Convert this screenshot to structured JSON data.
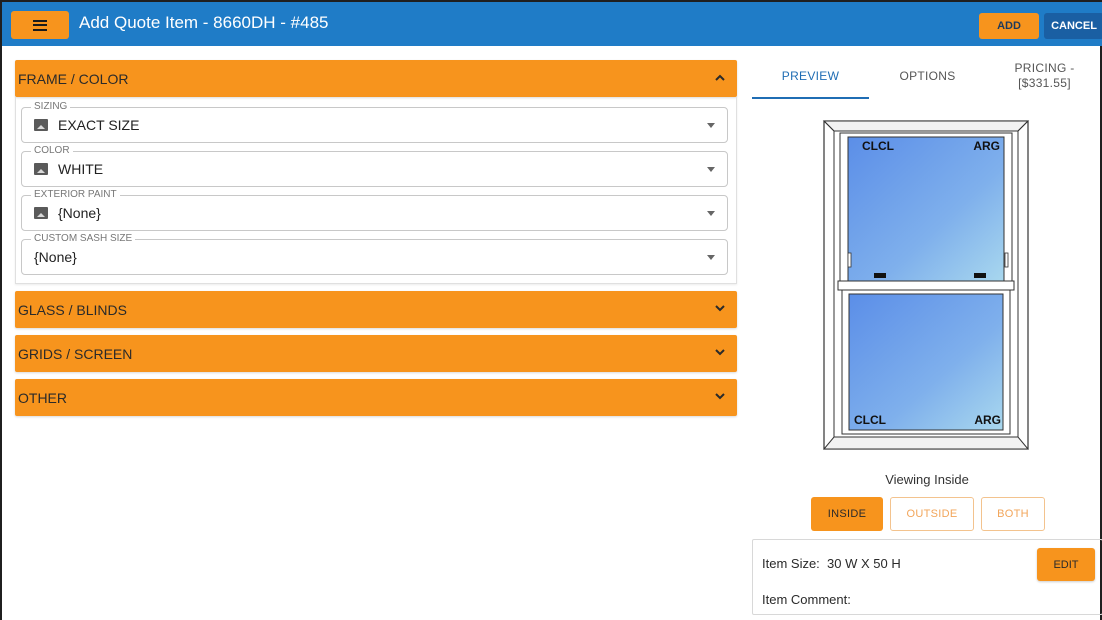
{
  "header": {
    "title": "Add Quote Item - 8660DH - #485",
    "add_label": "ADD",
    "cancel_label": "CANCEL",
    "menu_icon": "hamburger-menu-icon"
  },
  "sections": {
    "frame_color": {
      "label": "FRAME / COLOR",
      "expanded": true,
      "fields": [
        {
          "label": "SIZING",
          "value": "EXACT SIZE",
          "icon": "image-icon"
        },
        {
          "label": "COLOR",
          "value": "WHITE",
          "icon": "image-icon"
        },
        {
          "label": "EXTERIOR PAINT",
          "value": "{None}",
          "icon": "image-icon"
        },
        {
          "label": "CUSTOM SASH SIZE",
          "value": "{None}"
        }
      ]
    },
    "glass_blinds": {
      "label": "GLASS / BLINDS",
      "expanded": false
    },
    "grids_screen": {
      "label": "GRIDS / SCREEN",
      "expanded": false
    },
    "other": {
      "label": "OTHER",
      "expanded": false
    }
  },
  "tabs": {
    "preview": "PREVIEW",
    "options": "OPTIONS",
    "pricing_line1": "PRICING -",
    "pricing_line2": "[$331.55]",
    "active": "PREVIEW"
  },
  "preview": {
    "top_sash_left": "CLCL",
    "top_sash_right": "ARG",
    "bottom_sash_left": "CLCL",
    "bottom_sash_right": "ARG",
    "viewing_text": "Viewing Inside"
  },
  "view_buttons": {
    "inside": "INSIDE",
    "outside": "OUTSIDE",
    "both": "BOTH",
    "selected": "INSIDE"
  },
  "item_info": {
    "size_label": "Item Size:",
    "size_value": "30 W X 50 H",
    "comment_label": "Item Comment:",
    "edit_label": "EDIT"
  },
  "colors": {
    "header_blue": "#1f7cc7",
    "accent_orange": "#f7941d",
    "tab_blue": "#1f6db4"
  }
}
